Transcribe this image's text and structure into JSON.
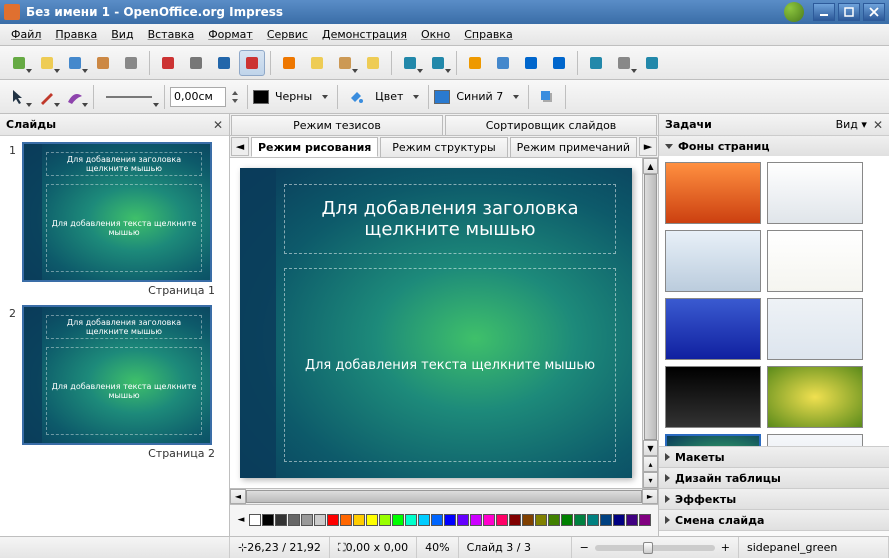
{
  "titlebar": {
    "title": "Без имени 1 - OpenOffice.org Impress"
  },
  "menus": [
    "Файл",
    "Правка",
    "Вид",
    "Вставка",
    "Формат",
    "Сервис",
    "Демонстрация",
    "Окно",
    "Справка"
  ],
  "toolbar1_icons": [
    "new",
    "open",
    "save",
    "mail",
    "edit",
    "pdf",
    "print",
    "spell",
    "autospell",
    "cut",
    "copy",
    "paste",
    "brush",
    "undo",
    "redo",
    "chart",
    "table",
    "link",
    "nav",
    "gallery",
    "zoom",
    "help"
  ],
  "toolbar2": {
    "arrow_icons": [
      "arrow",
      "line",
      "brush"
    ],
    "line_width_label": "0,00см",
    "color_black": "Черны",
    "fill_label": "Цвет",
    "color_blue7": "Синий 7"
  },
  "slidepanel": {
    "title": "Слайды",
    "slides": [
      {
        "num": "1",
        "caption": "Страница 1",
        "title_hint": "Для добавления заголовка щелкните мышью",
        "body_hint": "Для добавления текста щелкните мышью"
      },
      {
        "num": "2",
        "caption": "Страница 2",
        "title_hint": "Для добавления заголовка щелкните мышью",
        "body_hint": "Для добавления текста щелкните мышью"
      }
    ]
  },
  "view_tabs_top": [
    "Режим тезисов",
    "Сортировщик слайдов"
  ],
  "view_tabs_bot": [
    "Режим рисования",
    "Режим структуры",
    "Режим примечаний"
  ],
  "canvas": {
    "title_hint": "Для добавления заголовка щелкните мышью",
    "body_hint": "Для добавления текста щелкните мышью"
  },
  "color_row": [
    "#ffffff",
    "#000000",
    "#333333",
    "#666666",
    "#999999",
    "#cccccc",
    "#ff0000",
    "#ff6600",
    "#ffcc00",
    "#ffff00",
    "#99ff00",
    "#00ff00",
    "#00ffcc",
    "#00ccff",
    "#0066ff",
    "#0000ff",
    "#6600ff",
    "#cc00ff",
    "#ff00cc",
    "#ff0066",
    "#800000",
    "#804000",
    "#808000",
    "#408000",
    "#008000",
    "#008040",
    "#008080",
    "#004080",
    "#000080",
    "#400080",
    "#800080",
    "#800040",
    "#663333",
    "#336633",
    "#333366",
    "#996666",
    "#669966",
    "#666699",
    "#cc9999"
  ],
  "taskpanel": {
    "title": "Задачи",
    "view_label": "Вид",
    "sections": {
      "masters": "Фоны страниц",
      "layouts": "Макеты",
      "table": "Дизайн таблицы",
      "effects": "Эффекты",
      "transition": "Смена слайда"
    },
    "masters": [
      {
        "bg": "linear-gradient(#ff9040,#cc4010)"
      },
      {
        "bg": "linear-gradient(#fff,#e0e5ea)"
      },
      {
        "bg": "linear-gradient(#e8f0f8,#bcd)"
      },
      {
        "bg": "linear-gradient(#ffffff,#f5f5f0)"
      },
      {
        "bg": "linear-gradient(#3a5ad0,#1020a0)"
      },
      {
        "bg": "linear-gradient(#eef2f6,#dde5ee)"
      },
      {
        "bg": "linear-gradient(#000,#333)"
      },
      {
        "bg": "radial-gradient(#f0e050,#5a8a1a)"
      },
      {
        "bg": "radial-gradient(ellipse at 60% 55%, #3fc06a, #0a3a5a)",
        "sel": true
      },
      {
        "bg": "linear-gradient(#f5f7fa,#dfe6ee)"
      },
      {
        "bg": "linear-gradient(#1030a0,#0a1560)"
      },
      {
        "bg": "linear-gradient(#fff,#f0f0f0)"
      }
    ]
  },
  "statusbar": {
    "pos": "26,23 / 21,92",
    "size": "0,00 x 0,00",
    "zoom": "40%",
    "slide": "Слайд 3 / 3",
    "template": "sidepanel_green"
  }
}
